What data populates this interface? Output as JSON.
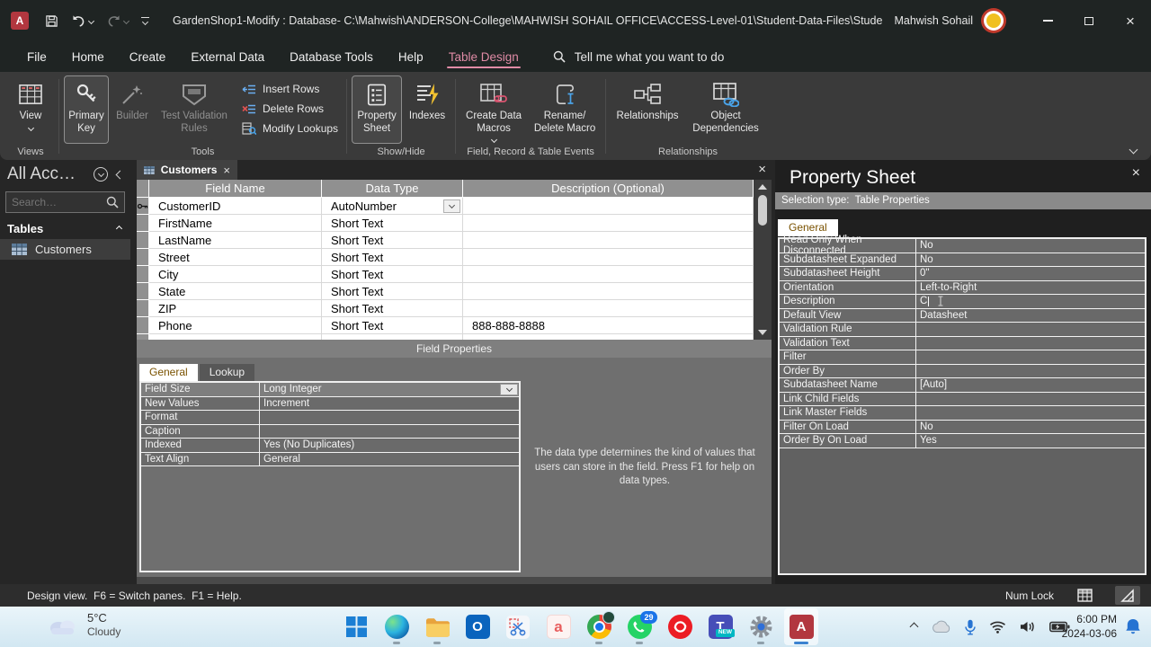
{
  "titlebar": {
    "title": "GardenShop1-Modify : Database- C:\\Mahwish\\ANDERSON-College\\MAHWISH SOHAIL OFFICE\\ACCESS-Level-01\\Student-Data-Files\\Student-Data…",
    "user_name": "Mahwish Sohail"
  },
  "menubar": {
    "tabs": [
      "File",
      "Home",
      "Create",
      "External Data",
      "Database Tools",
      "Help",
      "Table Design"
    ],
    "tell_me": "Tell me what you want to do"
  },
  "ribbon": {
    "view_label": "View",
    "views_group": "Views",
    "primary_key": "Primary Key",
    "builder": "Builder",
    "test_validation": "Test Validation Rules",
    "insert_rows": "Insert Rows",
    "delete_rows": "Delete Rows",
    "modify_lookups": "Modify Lookups",
    "tools_group": "Tools",
    "property_sheet": "Property Sheet",
    "indexes": "Indexes",
    "show_hide_group": "Show/Hide",
    "create_data_macros": "Create Data Macros",
    "rename_line1": "Rename/",
    "rename_line2": "Delete Macro",
    "events_group": "Field, Record & Table Events",
    "relationships": "Relationships",
    "object_dependencies": "Object Dependencies",
    "relationships_group": "Relationships"
  },
  "nav": {
    "title": "All Acc…",
    "search_placeholder": "Search…",
    "tables_group": "Tables",
    "items": [
      {
        "label": "Customers"
      }
    ]
  },
  "document": {
    "tab_label": "Customers",
    "grid_headers": [
      "Field Name",
      "Data Type",
      "Description (Optional)"
    ],
    "grid_rows": [
      {
        "field": "CustomerID",
        "type": "AutoNumber",
        "desc": ""
      },
      {
        "field": "FirstName",
        "type": "Short Text",
        "desc": ""
      },
      {
        "field": "LastName",
        "type": "Short Text",
        "desc": ""
      },
      {
        "field": "Street",
        "type": "Short Text",
        "desc": ""
      },
      {
        "field": "City",
        "type": "Short Text",
        "desc": ""
      },
      {
        "field": "State",
        "type": "Short Text",
        "desc": ""
      },
      {
        "field": "ZIP",
        "type": "Short Text",
        "desc": ""
      },
      {
        "field": "Phone",
        "type": "Short Text",
        "desc": "888-888-8888"
      }
    ],
    "divider_label": "Field Properties",
    "fp_tab_general": "General",
    "fp_tab_lookup": "Lookup",
    "fp_rows": [
      {
        "label": "Field Size",
        "value": "Long Integer"
      },
      {
        "label": "New Values",
        "value": "Increment"
      },
      {
        "label": "Format",
        "value": ""
      },
      {
        "label": "Caption",
        "value": ""
      },
      {
        "label": "Indexed",
        "value": "Yes (No Duplicates)"
      },
      {
        "label": "Text Align",
        "value": "General"
      }
    ],
    "help_text": "The data type determines the kind of values that users can store in the field. Press F1 for help on data types."
  },
  "property_sheet": {
    "title": "Property Sheet",
    "selection": "Selection type:  Table Properties",
    "tab_general": "General",
    "rows": [
      {
        "label": "Read Only When Disconnected",
        "value": "No"
      },
      {
        "label": "Subdatasheet Expanded",
        "value": "No"
      },
      {
        "label": "Subdatasheet Height",
        "value": "0\""
      },
      {
        "label": "Orientation",
        "value": "Left-to-Right"
      },
      {
        "label": "Description",
        "value": "C"
      },
      {
        "label": "Default View",
        "value": "Datasheet"
      },
      {
        "label": "Validation Rule",
        "value": ""
      },
      {
        "label": "Validation Text",
        "value": ""
      },
      {
        "label": "Filter",
        "value": ""
      },
      {
        "label": "Order By",
        "value": ""
      },
      {
        "label": "Subdatasheet Name",
        "value": "[Auto]"
      },
      {
        "label": "Link Child Fields",
        "value": ""
      },
      {
        "label": "Link Master Fields",
        "value": ""
      },
      {
        "label": "Filter On Load",
        "value": "No"
      },
      {
        "label": "Order By On Load",
        "value": "Yes"
      }
    ]
  },
  "status_bar": {
    "message": "Design view.  F6 = Switch panes.  F1 = Help.",
    "num_lock": "Num Lock"
  },
  "taskbar": {
    "weather_temp": "5°C",
    "weather_condition": "Cloudy",
    "whatsapp_badge": "29",
    "teams_badge": "NEW",
    "clock_time": "6:00 PM",
    "clock_date": "2024-03-06"
  },
  "icons": {
    "close": "×",
    "access_letter": "A",
    "outlook_letter": "O",
    "a_app_letter": "a",
    "teams_letter": "T"
  },
  "colors": {
    "accent_tab": "#e08ba6",
    "access_red": "#b2373f",
    "taskbar_active_underline": "#3b82d0"
  }
}
